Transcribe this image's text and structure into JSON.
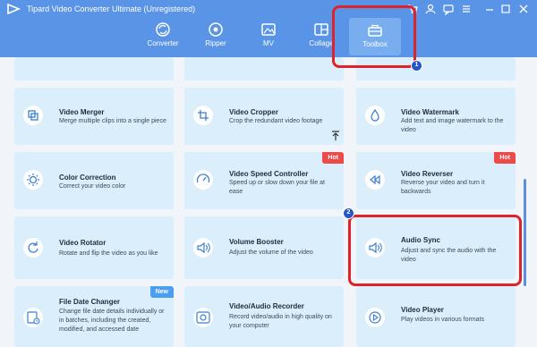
{
  "window": {
    "title": "Tipard Video Converter Ultimate (Unregistered)"
  },
  "nav": {
    "items": [
      {
        "label": "Converter",
        "icon": "converter-icon"
      },
      {
        "label": "Ripper",
        "icon": "ripper-icon"
      },
      {
        "label": "MV",
        "icon": "mv-icon"
      },
      {
        "label": "Collage",
        "icon": "collage-icon"
      },
      {
        "label": "Toolbox",
        "icon": "toolbox-icon",
        "active": true
      }
    ]
  },
  "tools": [
    {
      "title": "Video Merger",
      "desc": "Merge multiple clips into a single piece"
    },
    {
      "title": "Video Cropper",
      "desc": "Crop the redundant video footage"
    },
    {
      "title": "Video Watermark",
      "desc": "Add text and image watermark to the video"
    },
    {
      "title": "Color Correction",
      "desc": "Correct your video color"
    },
    {
      "title": "Video Speed Controller",
      "desc": "Speed up or slow down your file at ease",
      "badge": "Hot"
    },
    {
      "title": "Video Reverser",
      "desc": "Reverse your video and turn it backwards",
      "badge": "Hot"
    },
    {
      "title": "Video Rotator",
      "desc": "Rotate and flip the video as you like"
    },
    {
      "title": "Volume Booster",
      "desc": "Adjust the volume of the video"
    },
    {
      "title": "Audio Sync",
      "desc": "Adjust and sync the audio with the video"
    },
    {
      "title": "File Date Changer",
      "desc": "Change file date details individually or in batches, including the created, modified, and accessed date",
      "badge": "New"
    },
    {
      "title": "Video/Audio Recorder",
      "desc": "Record video/audio in high quality on your computer"
    },
    {
      "title": "Video Player",
      "desc": "Play videos in various formats"
    }
  ],
  "annotations": {
    "marker1": "1",
    "marker2": "2"
  },
  "colors": {
    "titlebar": "#5a94e6",
    "card": "#dbeefb",
    "highlight": "#e0232b",
    "hot": "#ef4a4a",
    "new": "#4a9ff0"
  }
}
